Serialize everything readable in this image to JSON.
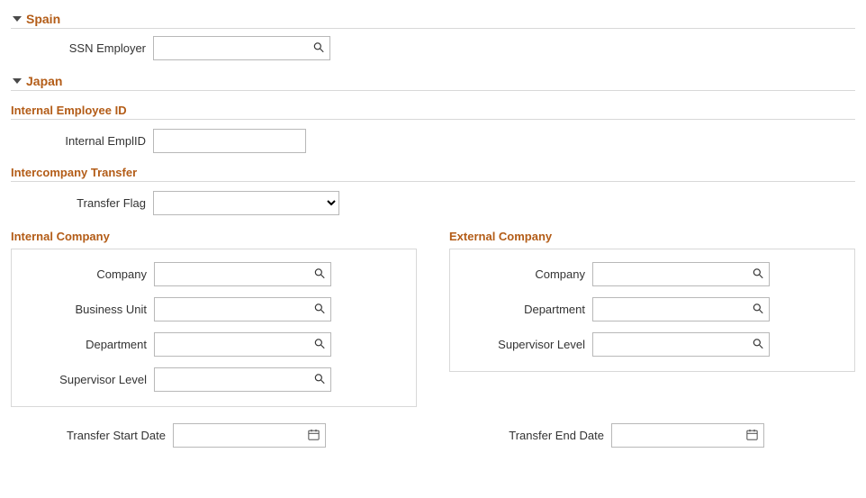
{
  "sections": {
    "spain": {
      "title": "Spain",
      "ssn_employer_label": "SSN Employer"
    },
    "japan": {
      "title": "Japan",
      "internal_employee_id": {
        "title": "Internal Employee ID",
        "emplid_label": "Internal EmplID"
      },
      "intercompany_transfer": {
        "title": "Intercompany Transfer",
        "transfer_flag_label": "Transfer Flag"
      },
      "internal_company": {
        "title": "Internal Company",
        "company_label": "Company",
        "business_unit_label": "Business Unit",
        "department_label": "Department",
        "supervisor_level_label": "Supervisor Level"
      },
      "external_company": {
        "title": "External Company",
        "company_label": "Company",
        "department_label": "Department",
        "supervisor_level_label": "Supervisor Level"
      },
      "transfer_start_label": "Transfer Start Date",
      "transfer_end_label": "Transfer End Date"
    }
  }
}
